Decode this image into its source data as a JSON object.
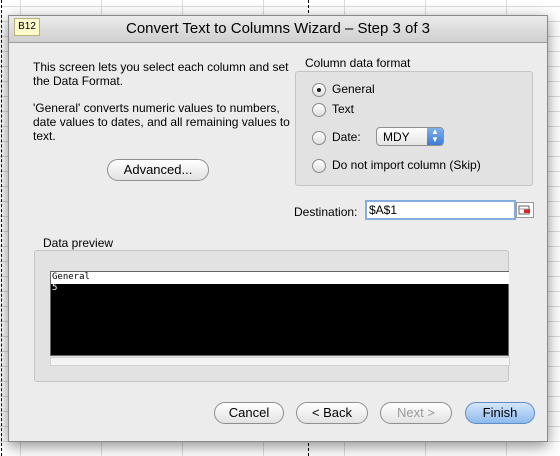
{
  "cell_ref": "B12",
  "dialog": {
    "title": "Convert Text to Columns Wizard – Step 3 of 3",
    "description_1": "This screen lets you select each column and set the Data Format.",
    "description_2": "'General' converts numeric values to numbers, date values to dates, and all remaining values to text.",
    "advanced_button": "Advanced..."
  },
  "column_format": {
    "label": "Column data format",
    "options": [
      {
        "label": "General",
        "selected": true
      },
      {
        "label": "Text",
        "selected": false
      },
      {
        "label": "Date:",
        "selected": false
      },
      {
        "label": "Do not import column (Skip)",
        "selected": false
      }
    ],
    "date_format": "MDY"
  },
  "destination": {
    "label": "Destination:",
    "value": "$A$1"
  },
  "preview": {
    "label": "Data preview",
    "column_header": "General",
    "cell_value": "5"
  },
  "buttons": {
    "cancel": "Cancel",
    "back": "< Back",
    "next": "Next >",
    "finish": "Finish"
  },
  "colors": {
    "default_button": "#8db9ee",
    "focus_ring": "#86abdf",
    "preview_background": "#000000"
  }
}
